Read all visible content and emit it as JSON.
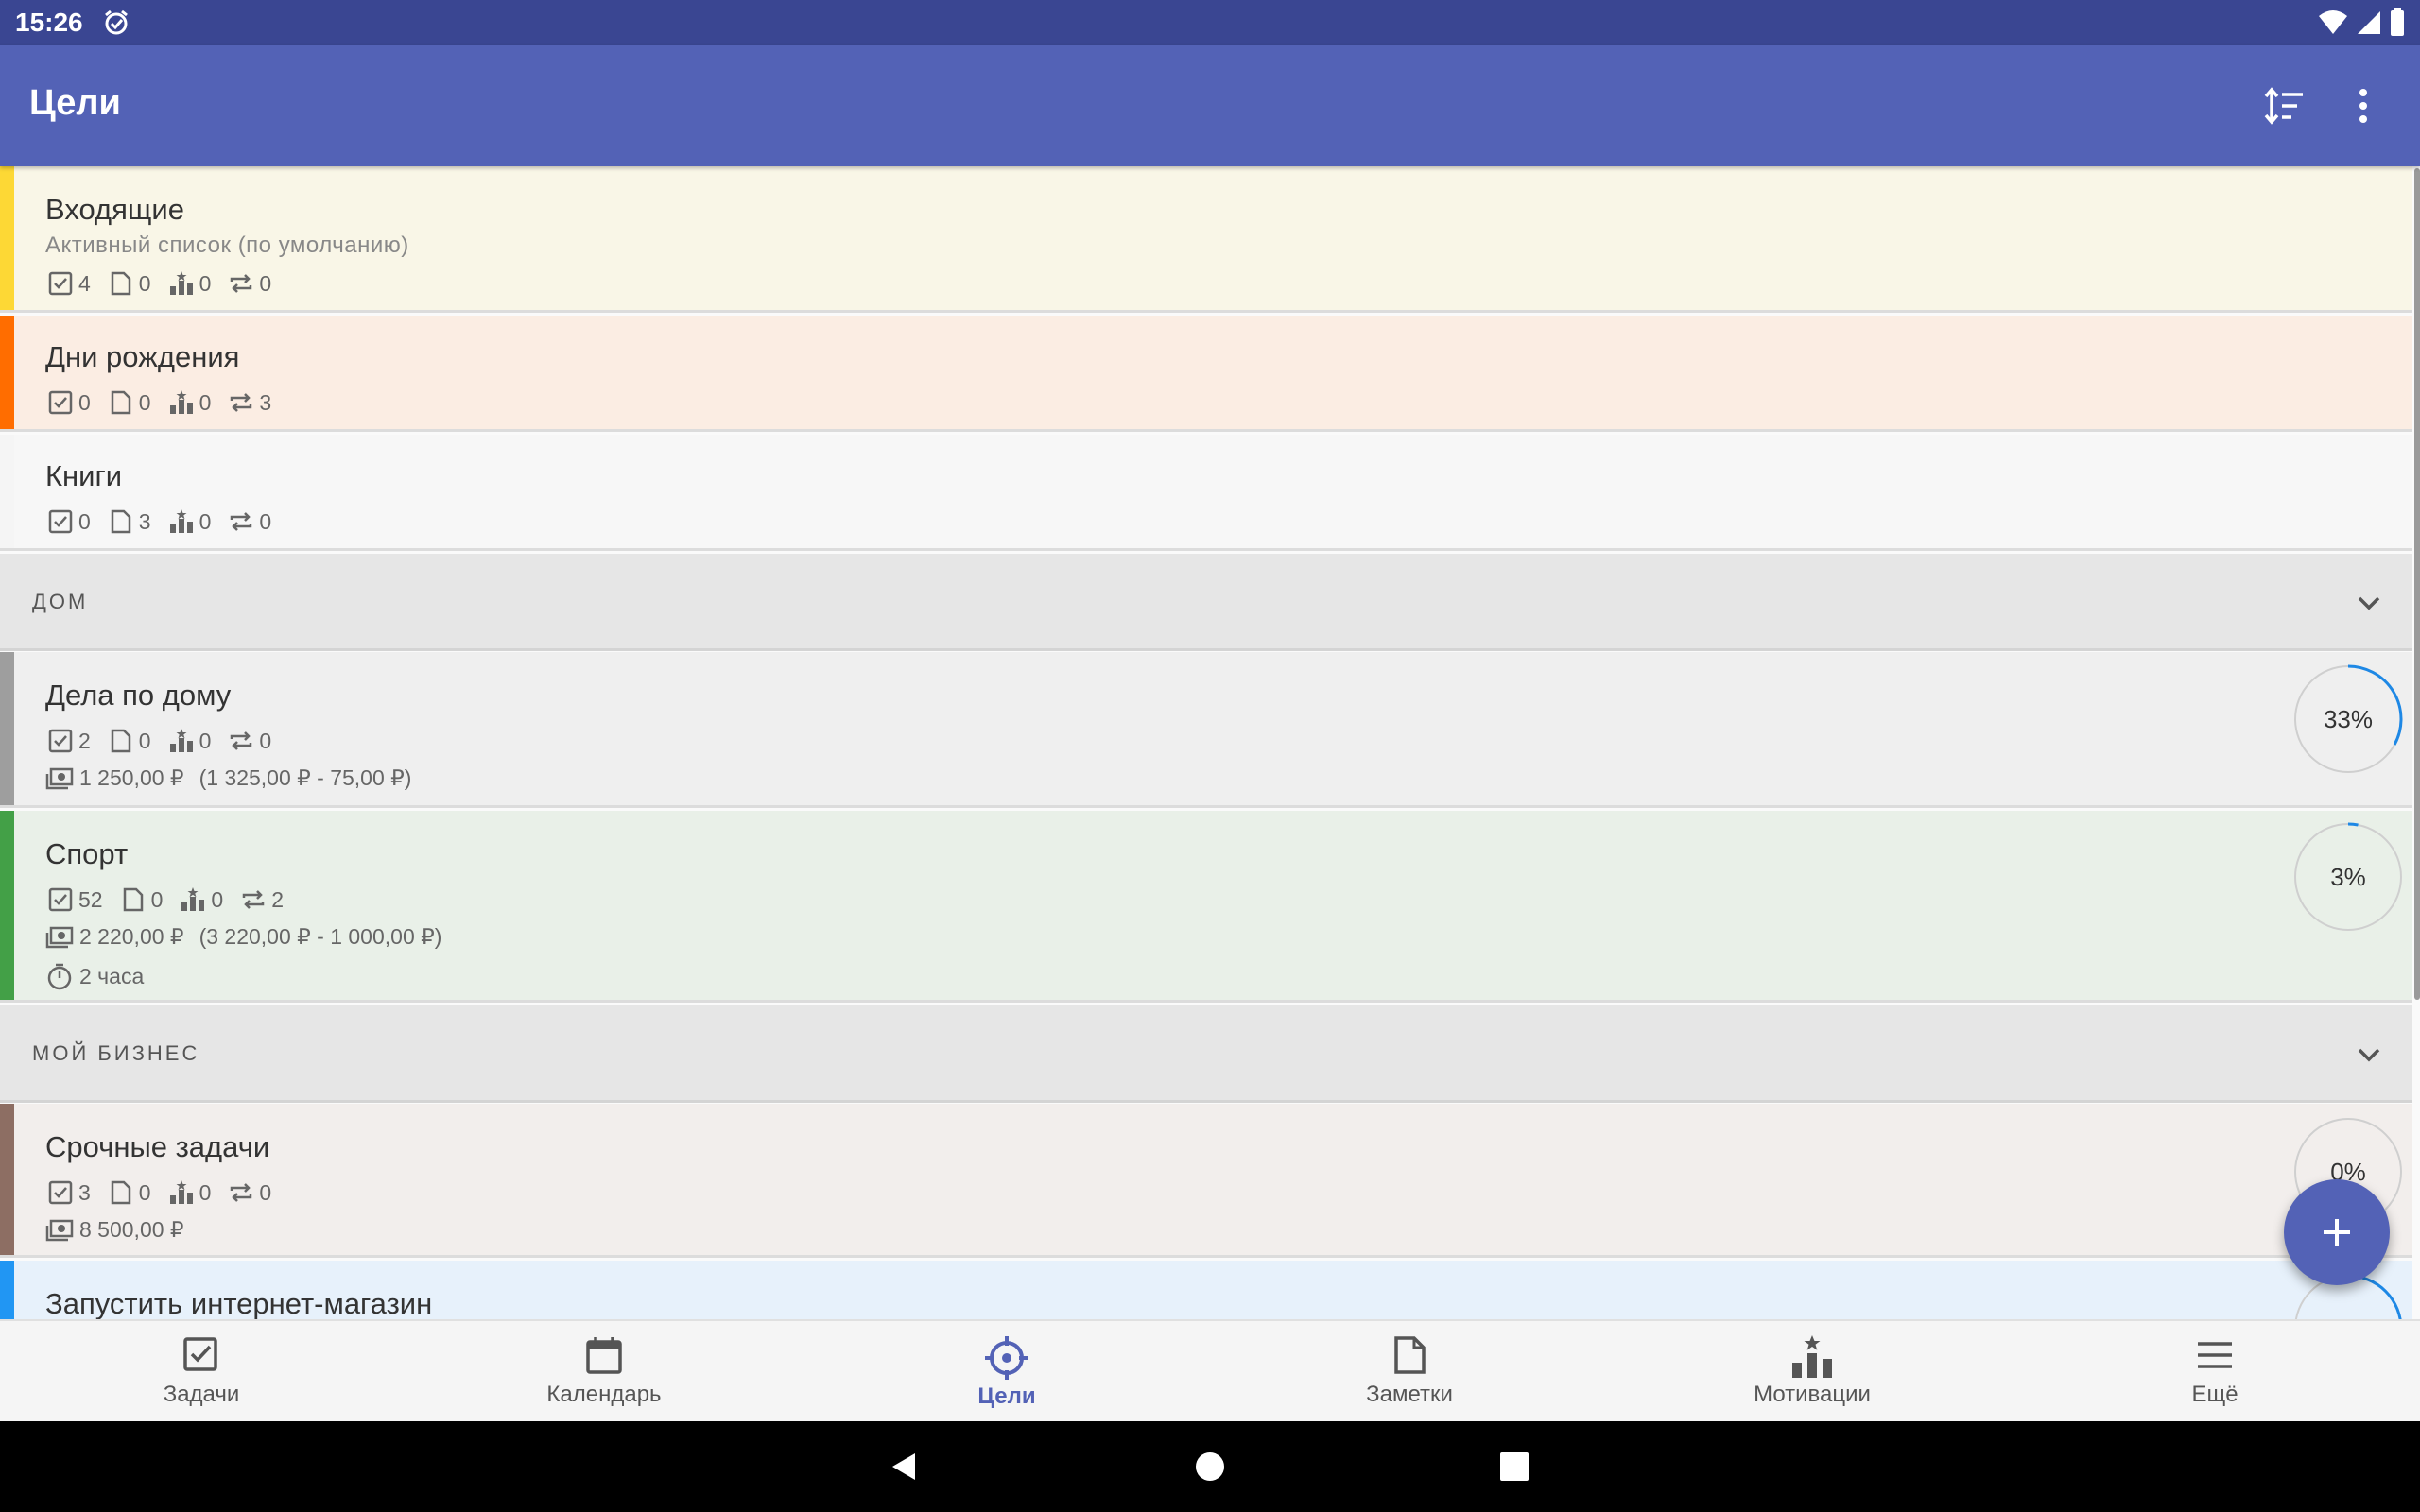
{
  "status_bar": {
    "time": "15:26"
  },
  "app_bar": {
    "title": "Цели",
    "sort_icon": "sort-icon",
    "more_icon": "more-vert-icon"
  },
  "lists": [
    {
      "name": "Входящие",
      "subtitle": "Активный список (по умолчанию)",
      "color": "#fdd835",
      "background": "#f9f6e7",
      "tasks": "4",
      "notes": "0",
      "motivations": "0",
      "recurring": "0"
    },
    {
      "name": "Дни рождения",
      "color": "#ff6d00",
      "background": "#fbede3",
      "tasks": "0",
      "notes": "0",
      "motivations": "0",
      "recurring": "3"
    },
    {
      "name": "Книги",
      "color": "#f5f5f5",
      "background": "#f7f7f7",
      "tasks": "0",
      "notes": "3",
      "motivations": "0",
      "recurring": "0"
    }
  ],
  "sections": [
    {
      "label": "ДОМ",
      "items": [
        {
          "name": "Дела по дому",
          "color": "#9e9e9e",
          "background": "#efefef",
          "tasks": "2",
          "notes": "0",
          "motivations": "0",
          "recurring": "0",
          "money": "1 250,00 ₽",
          "money_detail": "(1 325,00 ₽ - 75,00 ₽)",
          "progress_label": "33%",
          "progress": 0.33
        },
        {
          "name": "Спорт",
          "color": "#43a047",
          "background": "#e9f0e8",
          "tasks": "52",
          "notes": "0",
          "motivations": "0",
          "recurring": "2",
          "money": "2 220,00 ₽",
          "money_detail": "(3 220,00 ₽ - 1 000,00 ₽)",
          "time": "2 часа",
          "progress_label": "3%",
          "progress": 0.03
        }
      ]
    },
    {
      "label": "МОЙ БИЗНЕС",
      "items": [
        {
          "name": "Срочные задачи",
          "color": "#8d6e63",
          "background": "#f2eeec",
          "tasks": "3",
          "notes": "0",
          "motivations": "0",
          "recurring": "0",
          "money": "8 500,00 ₽",
          "progress_label": "0%",
          "progress": 0
        },
        {
          "name": "Запустить интернет-магазин",
          "color": "#2196f3",
          "background": "#e7f1fb"
        }
      ]
    }
  ],
  "fab": {
    "icon": "plus-icon"
  },
  "bottom_nav": [
    {
      "label": "Задачи",
      "icon": "checkbox-icon"
    },
    {
      "label": "Календарь",
      "icon": "calendar-icon"
    },
    {
      "label": "Цели",
      "icon": "target-icon",
      "active": true
    },
    {
      "label": "Заметки",
      "icon": "note-icon"
    },
    {
      "label": "Мотивации",
      "icon": "podium-icon"
    },
    {
      "label": "Ещё",
      "icon": "menu-icon"
    }
  ],
  "colors": {
    "status_bar": "#3a4692",
    "primary": "#5362b6",
    "progress_arc": "#1e88e5"
  }
}
